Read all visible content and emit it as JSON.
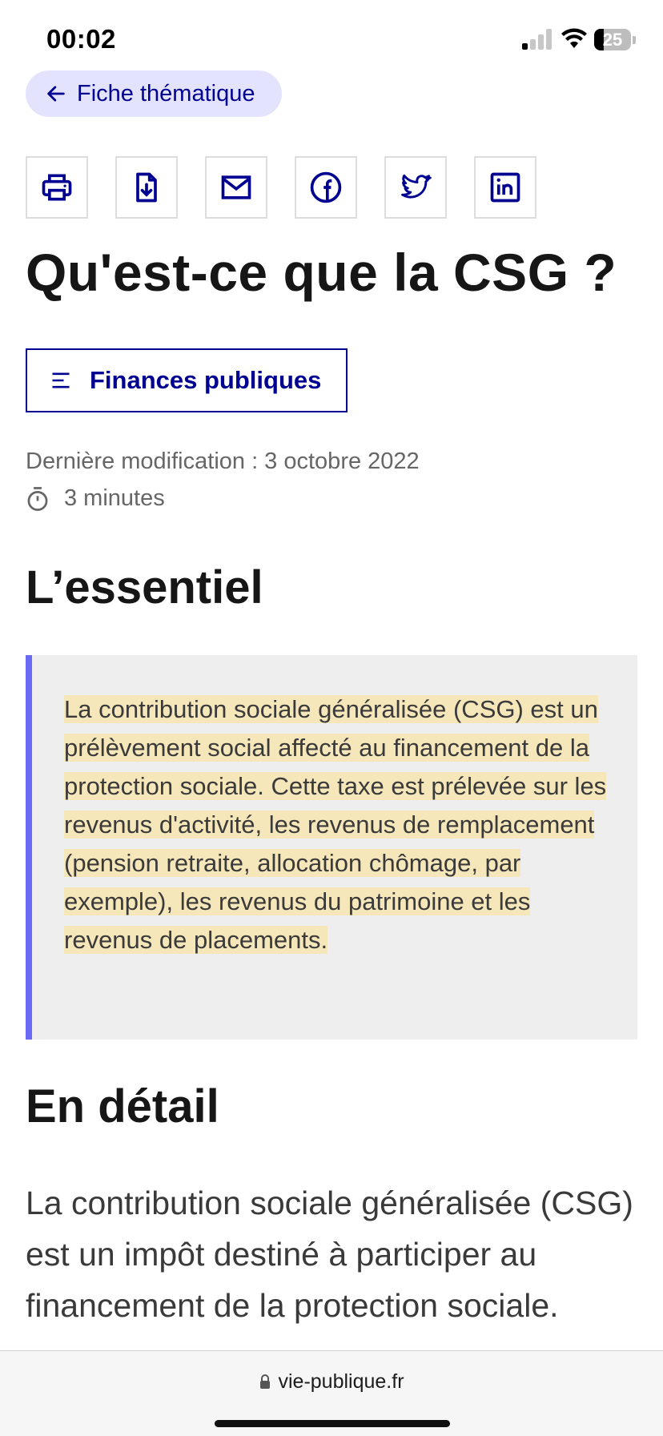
{
  "status_bar": {
    "time": "00:02",
    "battery_level": "25",
    "signal_bars_active": 1,
    "icons": [
      "signal-icon",
      "wifi-icon",
      "battery-icon"
    ]
  },
  "nav": {
    "back_label": "Fiche thématique",
    "back_icon": "arrow-left-icon"
  },
  "share": {
    "icons": [
      "print-icon",
      "download-icon",
      "mail-icon",
      "facebook-icon",
      "twitter-icon",
      "linkedin-icon"
    ]
  },
  "article": {
    "title": "Qu'est-ce que la CSG ?",
    "topic_label": "Finances publiques",
    "topic_icon": "menu-icon",
    "modified": "Dernière modification : 3 octobre 2022",
    "reading_time": "3 minutes",
    "essentiel_heading": "L’essentiel",
    "essentiel_text": "La contribution sociale généralisée (CSG) est un prélèvement social affecté au financement de la protection sociale. Cette taxe est prélevée sur les revenus d'activité, les revenus de remplacement (pension retraite, allocation chômage, par exemple), les revenus du patrimoine et les revenus de placements.",
    "detail_heading": "En détail",
    "detail_text": "La contribution sociale généralisée (CSG) est un impôt destiné à participer au financement de la protection sociale."
  },
  "browser": {
    "url": "vie-publique.fr",
    "lock_icon": "lock-icon"
  },
  "colors": {
    "brand_blue": "#000091",
    "tag_bg": "#e3e3fd",
    "callout_bar": "#6a6af4",
    "callout_bg": "#eeeeee",
    "highlight": "#f6e7bb"
  }
}
